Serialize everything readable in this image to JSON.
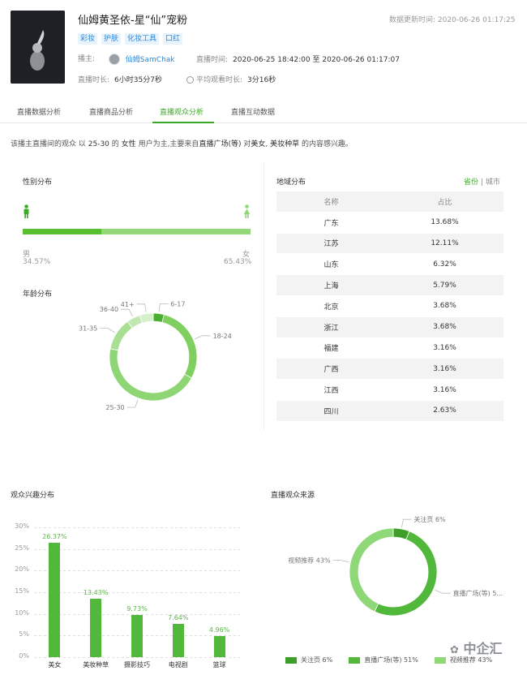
{
  "header": {
    "title": "仙姆黄圣依-星“仙”宠粉",
    "updated_label": "数据更新时间:",
    "updated_value": "2020-06-26 01:17:25",
    "tags": [
      "彩妆",
      "护肤",
      "化妆工具",
      "口红"
    ],
    "anchor_label": "播主:",
    "anchor_name": "仙姆SamChak",
    "live_time_label": "直播时间:",
    "live_time_value": "2020-06-25 18:42:00 至 2020-06-26 01:17:07",
    "duration_label": "直播时长:",
    "duration_value": "6小时35分7秒",
    "avg_watch_label": "平均观看时长:",
    "avg_watch_value": "3分16秒"
  },
  "tabs": [
    {
      "label": "直播数据分析",
      "active": false
    },
    {
      "label": "直播商品分析",
      "active": false
    },
    {
      "label": "直播观众分析",
      "active": true
    },
    {
      "label": "直播互动数据",
      "active": false
    }
  ],
  "summary": {
    "p1": "该播主直播间的观众 以",
    "age": "25-30",
    "p2": "的",
    "gender": "女性",
    "p3": "用户为主,主要来自",
    "source": "直播广场(等)",
    "p4": "对",
    "interest1": "美女",
    "sep": ",",
    "interest2": "美妆种草",
    "p5": "的内容感兴趣。"
  },
  "gender": {
    "title": "性别分布",
    "male_label": "男",
    "male_value": "34.57%",
    "male_share": 0.3457,
    "female_label": "女",
    "female_value": "65.43%",
    "colors": {
      "male": "#55bf2f",
      "female": "#93d878"
    }
  },
  "age": {
    "title": "年龄分布",
    "chart_data": {
      "type": "pie",
      "labels": [
        "6-17",
        "18-24",
        "25-30",
        "31-35",
        "36-40",
        "41+"
      ],
      "values": [
        4,
        29,
        45,
        12,
        5,
        5
      ],
      "colors": [
        "#4aae2e",
        "#7fd061",
        "#8ed574",
        "#a9df93",
        "#c2e8b2",
        "#d6f0cb"
      ]
    }
  },
  "region": {
    "title": "地域分布",
    "toggle_on": "省份",
    "toggle_sep": "|",
    "toggle_off": "城市",
    "headers": [
      "名称",
      "占比"
    ],
    "rows": [
      [
        "广东",
        "13.68%"
      ],
      [
        "江苏",
        "12.11%"
      ],
      [
        "山东",
        "6.32%"
      ],
      [
        "上海",
        "5.79%"
      ],
      [
        "北京",
        "3.68%"
      ],
      [
        "浙江",
        "3.68%"
      ],
      [
        "福建",
        "3.16%"
      ],
      [
        "广西",
        "3.16%"
      ],
      [
        "江西",
        "3.16%"
      ],
      [
        "四川",
        "2.63%"
      ]
    ]
  },
  "interest": {
    "title": "观众兴趣分布",
    "chart_data": {
      "type": "bar",
      "categories": [
        "美女",
        "美妆种草",
        "摄影技巧",
        "电视剧",
        "篮球"
      ],
      "values": [
        26.37,
        13.43,
        9.73,
        7.64,
        4.96
      ],
      "value_labels": [
        "26.37%",
        "13.43%",
        "9.73%",
        "7.64%",
        "4.96%"
      ],
      "yticks": [
        "30%",
        "25%",
        "20%",
        "15%",
        "10%",
        "5%",
        "0%"
      ],
      "ylim": [
        0,
        30
      ],
      "color": "#52b83b"
    }
  },
  "source": {
    "title": "直播观众来源",
    "chart_data": {
      "type": "pie",
      "labels": [
        "关注页",
        "直播广场(等)",
        "视频推荐"
      ],
      "values": [
        6,
        51,
        43
      ],
      "slice_labels": [
        "关注页 6%",
        "直播广场(等) 5...",
        "视频推荐 43%"
      ],
      "legend": [
        "关注页 6%",
        "直播广场(等) 51%",
        "视频推荐 43%"
      ],
      "colors": [
        "#3e9e27",
        "#52b83b",
        "#8fd878"
      ]
    }
  },
  "watermark": "中企汇"
}
